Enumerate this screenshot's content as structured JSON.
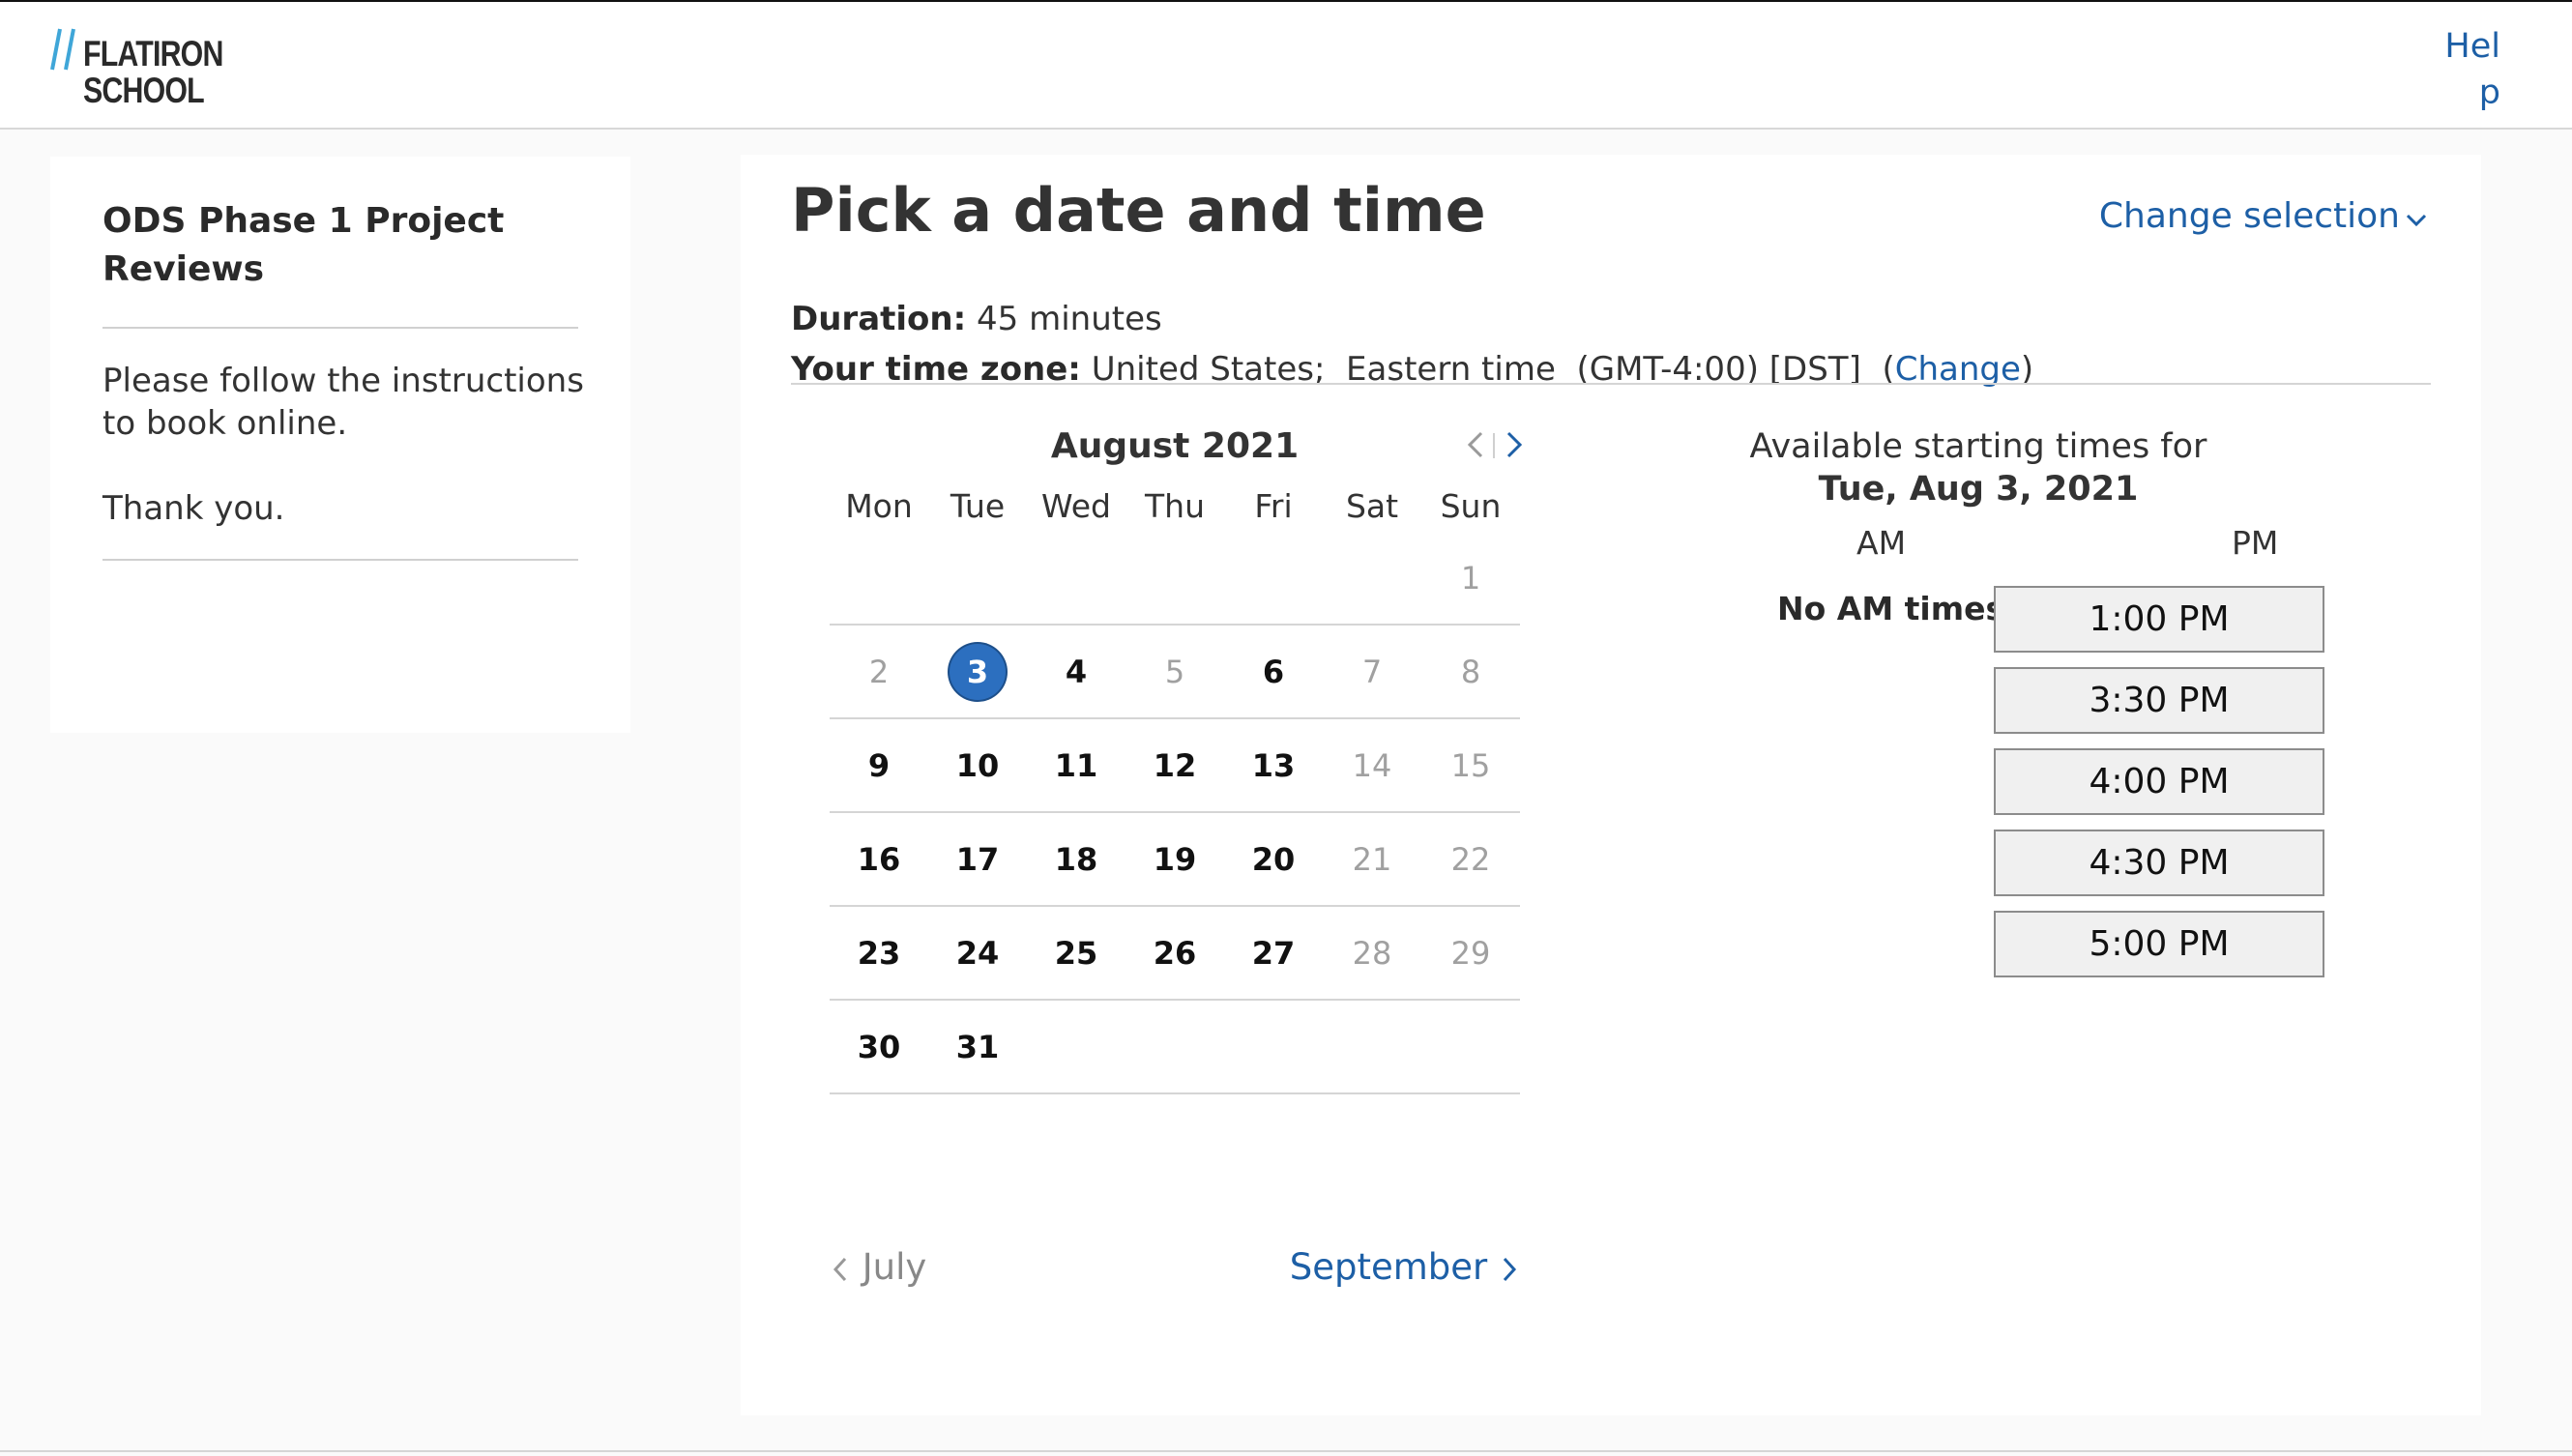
{
  "brand": {
    "logo_line1": "FLATIRON",
    "logo_line2": "SCHOOL",
    "accent_color": "#3fa6d8"
  },
  "header": {
    "help_label": "Help",
    "link_color": "#1d5fa6"
  },
  "sidebar": {
    "title": "ODS Phase 1 Project Reviews",
    "instructions": "Please follow the instructions to book online.",
    "thanks": "Thank you."
  },
  "main": {
    "title": "Pick a date and time",
    "change_selection_label": "Change selection",
    "duration_label": "Duration:",
    "duration_value": "45 minutes",
    "timezone_label": "Your time zone:",
    "timezone_value": "United States;  Eastern time  (GMT-4:00) [DST]  (",
    "timezone_change_label": "Change",
    "timezone_close": ")"
  },
  "calendar": {
    "month_title": "August 2021",
    "weekdays": [
      "Mon",
      "Tue",
      "Wed",
      "Thu",
      "Fri",
      "Sat",
      "Sun"
    ],
    "weeks": [
      [
        {
          "d": ""
        },
        {
          "d": ""
        },
        {
          "d": ""
        },
        {
          "d": ""
        },
        {
          "d": ""
        },
        {
          "d": ""
        },
        {
          "d": "1",
          "s": "unavail"
        }
      ],
      [
        {
          "d": "2",
          "s": "unavail"
        },
        {
          "d": "3",
          "s": "sel"
        },
        {
          "d": "4",
          "s": "avail"
        },
        {
          "d": "5",
          "s": "unavail"
        },
        {
          "d": "6",
          "s": "avail"
        },
        {
          "d": "7",
          "s": "unavail"
        },
        {
          "d": "8",
          "s": "unavail"
        }
      ],
      [
        {
          "d": "9",
          "s": "avail"
        },
        {
          "d": "10",
          "s": "avail"
        },
        {
          "d": "11",
          "s": "avail"
        },
        {
          "d": "12",
          "s": "avail"
        },
        {
          "d": "13",
          "s": "avail"
        },
        {
          "d": "14",
          "s": "unavail"
        },
        {
          "d": "15",
          "s": "unavail"
        }
      ],
      [
        {
          "d": "16",
          "s": "avail"
        },
        {
          "d": "17",
          "s": "avail"
        },
        {
          "d": "18",
          "s": "avail"
        },
        {
          "d": "19",
          "s": "avail"
        },
        {
          "d": "20",
          "s": "avail"
        },
        {
          "d": "21",
          "s": "unavail"
        },
        {
          "d": "22",
          "s": "unavail"
        }
      ],
      [
        {
          "d": "23",
          "s": "avail"
        },
        {
          "d": "24",
          "s": "avail"
        },
        {
          "d": "25",
          "s": "avail"
        },
        {
          "d": "26",
          "s": "avail"
        },
        {
          "d": "27",
          "s": "avail"
        },
        {
          "d": "28",
          "s": "unavail"
        },
        {
          "d": "29",
          "s": "unavail"
        }
      ],
      [
        {
          "d": "30",
          "s": "avail"
        },
        {
          "d": "31",
          "s": "avail"
        },
        {
          "d": ""
        },
        {
          "d": ""
        },
        {
          "d": ""
        },
        {
          "d": ""
        },
        {
          "d": ""
        }
      ]
    ],
    "prev_month_label": "July",
    "next_month_label": "September",
    "selected_color": "#2c6fbf"
  },
  "times": {
    "heading": "Available starting times for",
    "date_label": "Tue, Aug 3, 2021",
    "am_label": "AM",
    "pm_label": "PM",
    "no_am_label": "No AM times",
    "pm_slots": [
      "1:00 PM",
      "3:30 PM",
      "4:00 PM",
      "4:30 PM",
      "5:00 PM"
    ]
  }
}
